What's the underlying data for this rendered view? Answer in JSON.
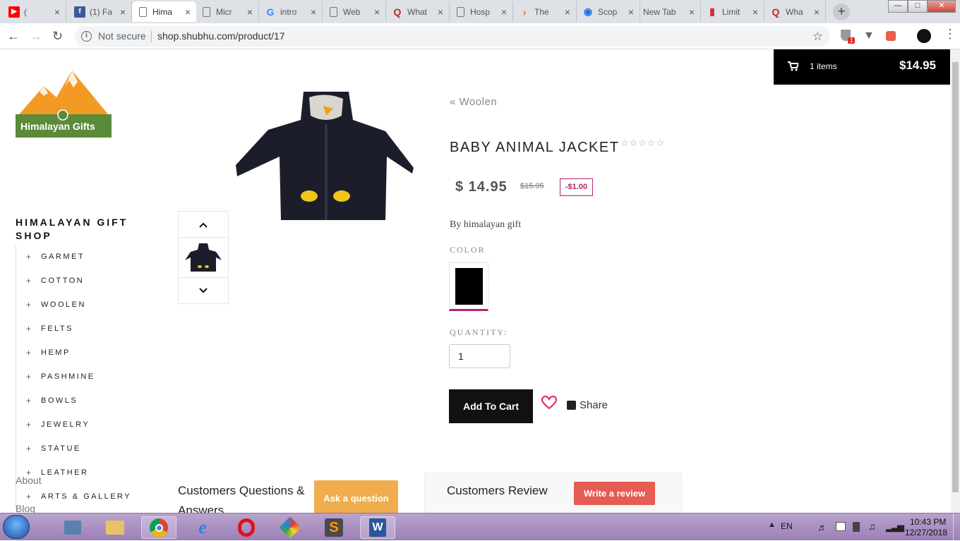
{
  "tabs": [
    {
      "label": "(",
      "icon": "youtube-icon",
      "color": "#ff0000"
    },
    {
      "label": "(1) Fa",
      "icon": "facebook-icon",
      "color": "#3b5998"
    },
    {
      "label": "Hima",
      "icon": "page-icon",
      "color": "#777"
    },
    {
      "label": "Micr",
      "icon": "page-icon",
      "color": "#777"
    },
    {
      "label": "intro",
      "icon": "google-icon",
      "color": "#4285f4"
    },
    {
      "label": "Web",
      "icon": "page-icon",
      "color": "#777"
    },
    {
      "label": "What",
      "icon": "quora-icon",
      "color": "#b92b27"
    },
    {
      "label": "Hosp",
      "icon": "page-icon",
      "color": "#777"
    },
    {
      "label": "The",
      "icon": "chevron-icon",
      "color": "#f26522"
    },
    {
      "label": "Scop",
      "icon": "location-icon",
      "color": "#1a73e8"
    },
    {
      "label": "New Tab",
      "icon": "",
      "color": "#777"
    },
    {
      "label": "Limit",
      "icon": "chart-icon",
      "color": "#d32f2f"
    },
    {
      "label": "Wha",
      "icon": "quora-icon",
      "color": "#b92b27"
    }
  ],
  "address": {
    "security": "Not secure",
    "url": "shop.shubhu.com/product/17"
  },
  "extensions": {
    "badge": "1"
  },
  "cart": {
    "count_label": "1 items",
    "total": "$14.95"
  },
  "brand": {
    "logo_text": "Himalayan Gifts",
    "shop_title": "HIMALAYAN GIFT SHOP"
  },
  "categories": [
    "GARMET",
    "COTTON",
    "WOOLEN",
    "FELTS",
    "HEMP",
    "PASHMINE",
    "BOWLS",
    "JEWELRY",
    "STATUE",
    "LEATHER",
    "ARTS & GALLERY"
  ],
  "footer_links": [
    "About",
    "Blog"
  ],
  "product": {
    "breadcrumb": "« Woolen",
    "title": "BABY ANIMAL JACKET",
    "price": "$ 14.95",
    "old_price": "$15.95",
    "discount": "-$1.00",
    "by": "By himalayan gift",
    "color_label": "COLOR",
    "quantity_label": "QUANTITY:",
    "quantity": "1",
    "add_to_cart": "Add To Cart",
    "share": "Share",
    "rating_stars": 5
  },
  "questions": {
    "title": "Customers Questions & Answers",
    "ask_button": "Ask a question"
  },
  "reviews": {
    "title": "Customers Review",
    "write_button": "Write a review"
  },
  "colors": {
    "accent_pink": "#b0256f",
    "review_button": "#e55c52",
    "ask_button": "#f0ad4e",
    "logo_orange": "#f39a25",
    "logo_green": "#5b8a3a"
  },
  "system": {
    "language": "EN",
    "time": "10:43 PM",
    "date": "12/27/2018"
  }
}
